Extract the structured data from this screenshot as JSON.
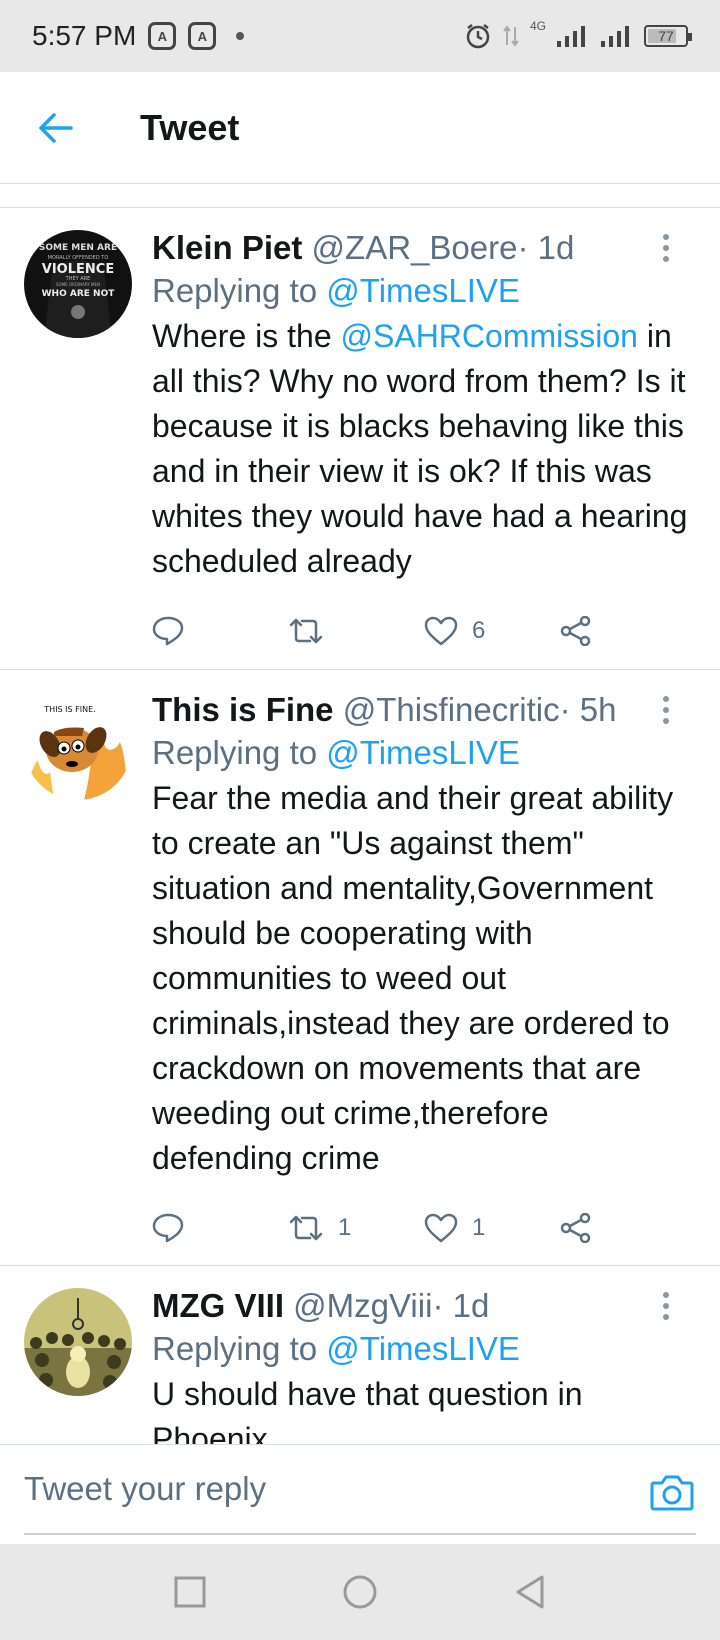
{
  "status_bar": {
    "time": "5:57 PM",
    "network": "4G",
    "battery": "77"
  },
  "header": {
    "title": "Tweet"
  },
  "tweets": [
    {
      "name": "Klein Piet",
      "handle": "@ZAR_Boere",
      "dot": "·",
      "time": "1d",
      "replying_prefix": "Replying to",
      "replying_to": "@TimesLIVE",
      "text_before": "Where is the",
      "mention": "@SAHRCommission",
      "text_after": "in all this? Why no word from them? Is it because it is blacks behaving like this and in their view it is ok? If this was whites they would have had a hearing scheduled already",
      "avatar_text": [
        "SOME MEN ARE",
        "MORALLY OFFENDED TO",
        "VIOLENCE",
        "THEY ARE",
        "SOME ORDINARY MEN",
        "WHO ARE NOT"
      ],
      "retweets": "",
      "likes": "6"
    },
    {
      "name": "This is Fine",
      "handle": "@Thisfinecritic",
      "dot": "·",
      "time": "5h",
      "replying_prefix": "Replying to",
      "replying_to": "@TimesLIVE",
      "text": "Fear the media and their great ability to create an \"Us against them\" situation and mentality,Government should be cooperating with communities to weed out criminals,instead they are ordered to crackdown on movements that are weeding out crime,therefore defending crime",
      "avatar_text": "THIS IS FINE.",
      "retweets": "1",
      "likes": "1"
    },
    {
      "name": "MZG VIII",
      "handle": "@MzgViii",
      "dot": "·",
      "time": "1d",
      "replying_prefix": "Replying to",
      "replying_to": "@TimesLIVE",
      "text": "U should have that question in Phoenix"
    }
  ],
  "reply_bar": {
    "placeholder": "Tweet your reply"
  },
  "icons": {
    "back": "arrow-left-icon",
    "more": "more-vertical-icon",
    "reply": "reply-icon",
    "retweet": "retweet-icon",
    "like": "heart-icon",
    "share": "share-icon",
    "camera": "camera-icon"
  },
  "colors": {
    "accent": "#1da1f2",
    "text": "#14171a",
    "muted": "#5b7083",
    "divider": "#d7dde2"
  }
}
